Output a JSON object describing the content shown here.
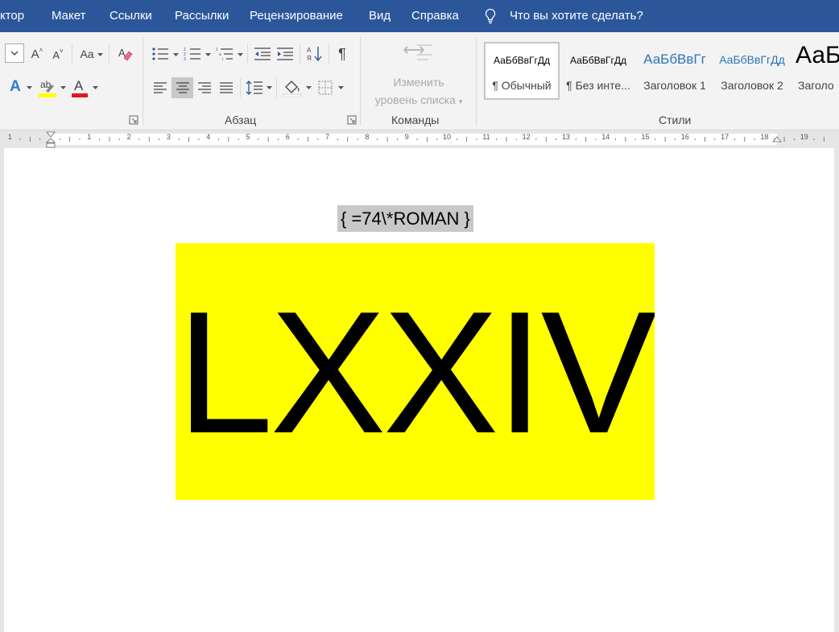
{
  "tabs": [
    "ктор",
    "Макет",
    "Ссылки",
    "Рассылки",
    "Рецензирование",
    "Вид",
    "Справка"
  ],
  "tell_me": "Что вы хотите сделать?",
  "ribbon": {
    "font": {
      "change_case_label": "Aa",
      "text_effects_label": "A",
      "highlight_label": "ab",
      "font_color_label": "A",
      "highlight_color": "#ffff00",
      "font_color": "#e81123"
    },
    "paragraph": {
      "label": "Абзац"
    },
    "commands": {
      "label": "Команды",
      "change_level_line1": "Изменить",
      "change_level_line2": "уровень списка"
    },
    "styles": {
      "label": "Стили",
      "items": [
        {
          "sample": "АаБбВвГгДд",
          "name": "¶ Обычный"
        },
        {
          "sample": "АаБбВвГгДд",
          "name": "¶ Без инте..."
        },
        {
          "sample": "АаБбВвГг",
          "name": "Заголовок 1"
        },
        {
          "sample": "АаБбВвГгДд",
          "name": "Заголовок 2"
        },
        {
          "sample": "АаБ",
          "name": "Заголо"
        }
      ]
    }
  },
  "ruler": {
    "numbers": [
      "1",
      "1",
      "2",
      "3",
      "4",
      "5",
      "6",
      "7",
      "8",
      "9",
      "10",
      "11",
      "12",
      "13",
      "14",
      "15",
      "16",
      "17",
      "18",
      "19"
    ]
  },
  "document": {
    "field_code": "{ =74\\*ROMAN }",
    "result": "LXXIV",
    "result_background": "#ffff00"
  },
  "colors": {
    "accent": "#2b579a"
  }
}
